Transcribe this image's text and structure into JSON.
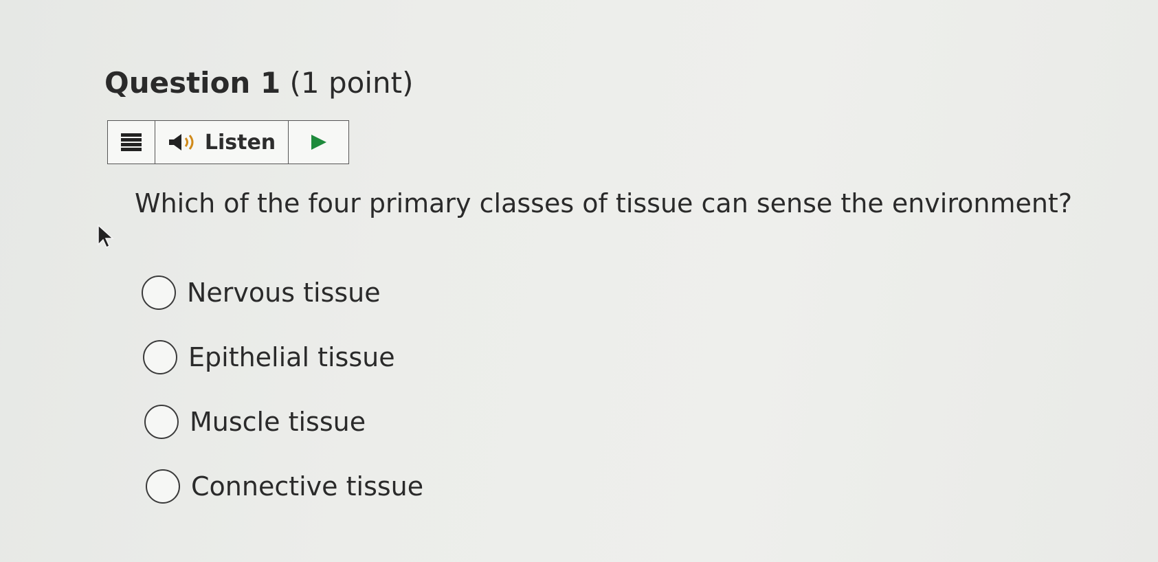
{
  "question": {
    "label": "Question 1",
    "points": "(1 point)",
    "text": "Which of the four primary classes of tissue can sense the environment?"
  },
  "toolbar": {
    "menu_icon": "hamburger-menu-icon",
    "speaker_icon": "speaker-icon",
    "listen_label": "Listen",
    "play_icon": "play-icon"
  },
  "options": [
    {
      "label": "Nervous tissue",
      "selected": false
    },
    {
      "label": "Epithelial tissue",
      "selected": false
    },
    {
      "label": "Muscle tissue",
      "selected": false
    },
    {
      "label": "Connective tissue",
      "selected": false
    }
  ],
  "colors": {
    "text": "#2a2a2a",
    "play_accent": "#1e8a3c",
    "border": "#555555"
  }
}
